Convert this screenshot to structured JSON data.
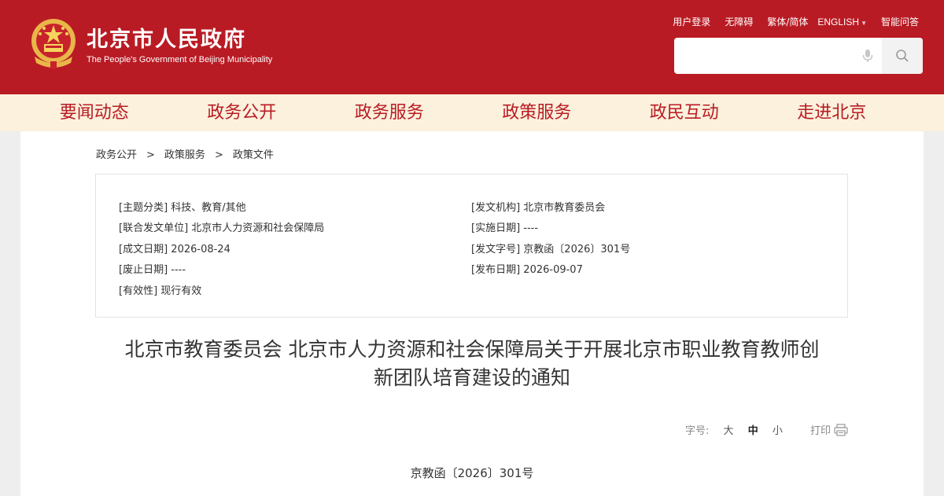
{
  "header": {
    "title": "北京市人民政府",
    "subtitle": "The People's Government of Beijing Municipality",
    "links": {
      "login": "用户登录",
      "accessibility": "无障碍",
      "traditional": "繁体/简体",
      "english": "ENGLISH",
      "qa": "智能问答"
    },
    "search": {
      "placeholder": ""
    },
    "colors": {
      "brand": "#b91b24",
      "nav_bg": "#fbf1dc"
    }
  },
  "nav": {
    "items": [
      "要闻动态",
      "政务公开",
      "政务服务",
      "政策服务",
      "政民互动",
      "走进北京"
    ]
  },
  "breadcrumb": [
    "政务公开",
    "政策服务",
    "政策文件"
  ],
  "breadcrumb_sep": ">",
  "meta": {
    "topic": {
      "key": "[主题分类]",
      "value": "科技、教育/其他"
    },
    "issuer": {
      "key": "[发文机构]",
      "value": "北京市教育委员会"
    },
    "joint": {
      "key": "[联合发文单位]",
      "value": "北京市人力资源和社会保障局"
    },
    "effective": {
      "key": "[实施日期]",
      "value": "----"
    },
    "written": {
      "key": "[成文日期]",
      "value": "2026-08-24"
    },
    "docno": {
      "key": "[发文字号]",
      "value": "京教函〔2026〕301号"
    },
    "repeal": {
      "key": "[废止日期]",
      "value": "----"
    },
    "published": {
      "key": "[发布日期]",
      "value": "2026-09-07"
    },
    "validity": {
      "key": "[有效性]",
      "value": "现行有效"
    }
  },
  "document": {
    "title_line1": "北京市教育委员会 北京市人力资源和社会保障局关于开展北京市职业教育教师创",
    "title_line2": "新团队培育建设的通知",
    "number": "京教函〔2026〕301号"
  },
  "tools": {
    "font_label": "字号:",
    "large": "大",
    "medium": "中",
    "small": "小",
    "print": "打印"
  }
}
